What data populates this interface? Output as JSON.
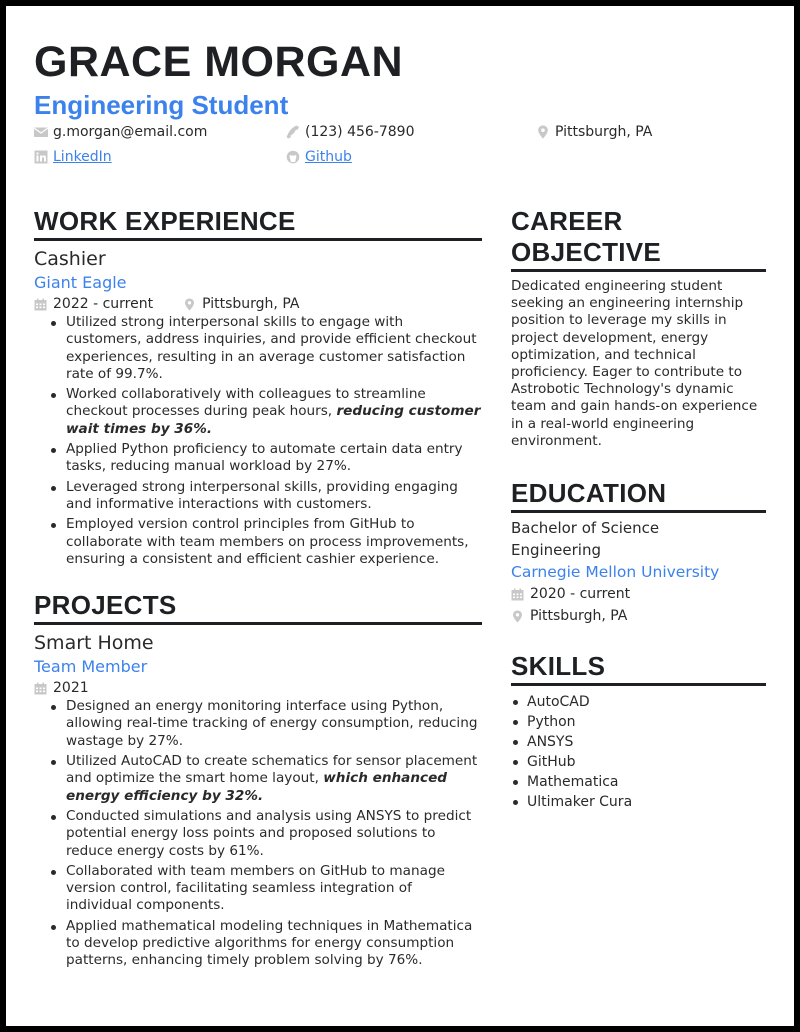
{
  "header": {
    "name": "GRACE MORGAN",
    "title": "Engineering Student"
  },
  "contacts": {
    "email": {
      "icon": "envelope-icon",
      "text": "g.morgan@email.com"
    },
    "phone": {
      "icon": "phone-icon",
      "text": "(123) 456-7890"
    },
    "location": {
      "icon": "map-pin-icon",
      "text": "Pittsburgh, PA"
    },
    "linkedin": {
      "icon": "linkedin-icon",
      "text": "LinkedIn"
    },
    "github": {
      "icon": "github-icon",
      "text": "Github"
    }
  },
  "colors": {
    "accent": "#3b82ec",
    "heading": "#1e2024",
    "text": "#2a2a2a",
    "icon": "#c8c8c8",
    "frame": "#000000"
  },
  "work": {
    "heading": "WORK EXPERIENCE",
    "jobs": [
      {
        "role": "Cashier",
        "company": "Giant Eagle",
        "dates": "2022 - current",
        "location": "Pittsburgh, PA",
        "bullets": [
          {
            "text": "Utilized strong interpersonal skills to engage with customers, address inquiries, and provide efficient checkout experiences, resulting in an average customer satisfaction rate of 99.7%.",
            "emph": ""
          },
          {
            "text": "Worked collaboratively with colleagues to streamline checkout processes during peak hours, ",
            "emph": "reducing customer wait times by 36%."
          },
          {
            "text": "Applied Python proficiency to automate certain data entry tasks, reducing manual workload by 27%.",
            "emph": ""
          },
          {
            "text": "Leveraged strong interpersonal skills, providing engaging and informative interactions with customers.",
            "emph": ""
          },
          {
            "text": "Employed version control principles from GitHub to collaborate with team members on process improvements, ensuring a consistent and efficient cashier experience.",
            "emph": ""
          }
        ]
      }
    ]
  },
  "projects": {
    "heading": "PROJECTS",
    "items": [
      {
        "name": "Smart Home",
        "role": "Team Member",
        "dates": "2021",
        "bullets": [
          {
            "text": "Designed an energy monitoring interface using Python, allowing real-time tracking of energy consumption, reducing wastage by 27%.",
            "emph": ""
          },
          {
            "text": "Utilized AutoCAD to create schematics for sensor placement and optimize the smart home layout, ",
            "emph": "which enhanced energy efficiency by 32%."
          },
          {
            "text": "Conducted simulations and analysis using ANSYS to predict potential energy loss points and proposed solutions to reduce energy costs by 61%.",
            "emph": ""
          },
          {
            "text": "Collaborated with team members on GitHub to manage version control, facilitating seamless integration of individual components.",
            "emph": ""
          },
          {
            "text": "Applied mathematical modeling techniques in Mathematica to develop predictive algorithms for energy consumption patterns, enhancing timely problem solving by 76%.",
            "emph": ""
          }
        ]
      }
    ]
  },
  "objective": {
    "heading_line1": "CAREER",
    "heading_line2": "OBJECTIVE",
    "text": "Dedicated engineering student seeking an engineering internship position to leverage my skills in project development, energy optimization, and technical proficiency. Eager to contribute to Astrobotic Technology's dynamic team and gain hands-on experience in a real-world engineering environment."
  },
  "education": {
    "heading": "EDUCATION",
    "degree": "Bachelor of Science",
    "field": "Engineering",
    "school": "Carnegie Mellon University",
    "dates": "2020 - current",
    "location": "Pittsburgh, PA"
  },
  "skills": {
    "heading": "SKILLS",
    "items": [
      "AutoCAD",
      "Python",
      "ANSYS",
      "GitHub",
      "Mathematica",
      "Ultimaker Cura"
    ]
  }
}
